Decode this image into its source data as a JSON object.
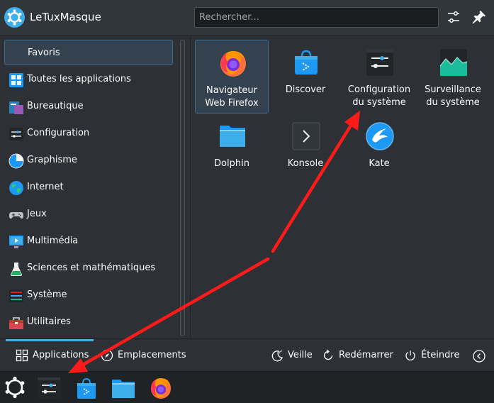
{
  "header": {
    "user_name": "LeTuxMasque",
    "search_placeholder": "Rechercher..."
  },
  "sidebar": {
    "items": [
      {
        "label": "Favoris",
        "icon": "star-icon",
        "active": true
      },
      {
        "label": "Toutes les applications",
        "icon": "grid-icon"
      },
      {
        "label": "Bureautique",
        "icon": "office-icon"
      },
      {
        "label": "Configuration",
        "icon": "settings-icon"
      },
      {
        "label": "Graphisme",
        "icon": "graphics-icon"
      },
      {
        "label": "Internet",
        "icon": "globe-icon"
      },
      {
        "label": "Jeux",
        "icon": "gamepad-icon"
      },
      {
        "label": "Multimédia",
        "icon": "monitor-icon"
      },
      {
        "label": "Sciences et mathématiques",
        "icon": "flask-icon"
      },
      {
        "label": "Système",
        "icon": "system-icon"
      },
      {
        "label": "Utilitaires",
        "icon": "toolbox-icon"
      }
    ]
  },
  "favorites": [
    {
      "label": "Navigateur\nWeb Firefox",
      "icon": "firefox-icon",
      "selected": true
    },
    {
      "label": "Discover",
      "icon": "discover-icon"
    },
    {
      "label": "Configuration\ndu système",
      "icon": "system-settings-icon"
    },
    {
      "label": "Surveillance\ndu système",
      "icon": "system-monitor-icon"
    },
    {
      "label": "Dolphin",
      "icon": "dolphin-folder-icon"
    },
    {
      "label": "Konsole",
      "icon": "konsole-icon"
    },
    {
      "label": "Kate",
      "icon": "kate-icon"
    }
  ],
  "footer": {
    "tabs": [
      {
        "label": "Applications",
        "icon": "grid-icon",
        "active": true
      },
      {
        "label": "Emplacements",
        "icon": "compass-icon"
      }
    ],
    "power": [
      {
        "label": "Veille",
        "icon": "sleep-icon"
      },
      {
        "label": "Redémarrer",
        "icon": "restart-icon"
      },
      {
        "label": "Éteindre",
        "icon": "power-icon"
      }
    ]
  },
  "taskbar": {
    "items": [
      {
        "icon": "kde-launcher-icon"
      },
      {
        "icon": "system-settings-icon"
      },
      {
        "icon": "discover-icon"
      },
      {
        "icon": "dolphin-folder-icon"
      },
      {
        "icon": "firefox-icon"
      }
    ]
  },
  "colors": {
    "accent": "#3daee9",
    "annotation": "#ff1a1a"
  }
}
